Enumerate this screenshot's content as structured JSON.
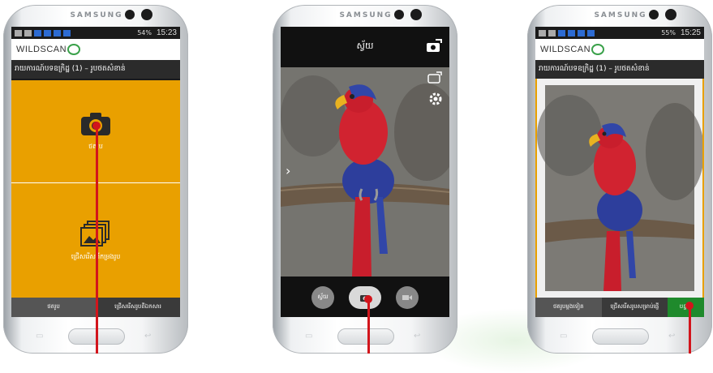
{
  "brand": "SAMSUNG",
  "colors": {
    "tile": "#e9a000",
    "accent_green": "#1f8a2c",
    "pointer": "#d2151c",
    "bar_dark": "#3a3a3a"
  },
  "phone1": {
    "status": {
      "battery": "54%",
      "time": "15:23"
    },
    "app_logo": "WILDSCAN",
    "title": "រាយការណ៍បទឧក្រិដ្ឋ (1) – រូបថតសំខាន់",
    "tile_camera": {
      "label": "ថតរូប",
      "icon": "camera-icon"
    },
    "tile_gallery": {
      "label": "ជ្រើសរើសពីកម្រងរូប",
      "icon": "gallery-icon"
    },
    "bottom": [
      "ថតរូប",
      "ជ្រើសរើសរូបពីឯកសារ"
    ]
  },
  "phone2": {
    "title": "ស្វ័យ",
    "mode_left": "ស្វ័យ",
    "icons": [
      "switch-camera-icon",
      "settings-icon",
      "shutter-icon",
      "video-icon"
    ]
  },
  "phone3": {
    "status": {
      "battery": "55%",
      "time": "15:25"
    },
    "app_logo": "WILDSCAN",
    "title": "រាយការណ៍បទឧក្រិដ្ឋ (1) – រូបថតសំខាន់",
    "bottom": [
      "ថតរូបម្តងទៀត",
      "ជ្រើសរើសរូបសម្រាប់ផ្ញើ",
      "បន្ទាប់"
    ]
  }
}
